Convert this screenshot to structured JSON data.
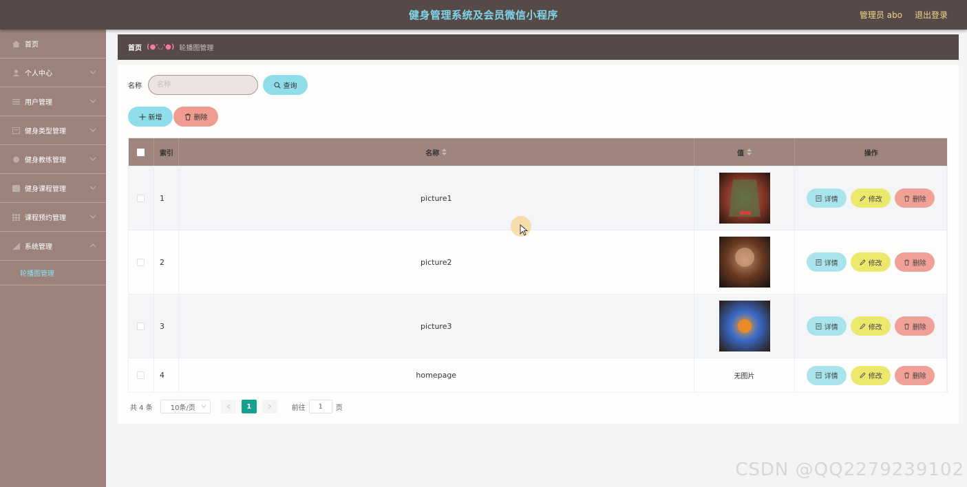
{
  "header": {
    "title": "健身管理系统及会员微信小程序",
    "user": "管理员 abo",
    "logout": "退出登录"
  },
  "sidebar": {
    "items": [
      {
        "label": "首页",
        "icon": "home-icon",
        "has_chevron": false
      },
      {
        "label": "个人中心",
        "icon": "user-icon",
        "has_chevron": true
      },
      {
        "label": "用户管理",
        "icon": "list-icon",
        "has_chevron": true
      },
      {
        "label": "健身类型管理",
        "icon": "category-icon",
        "has_chevron": true
      },
      {
        "label": "健身教练管理",
        "icon": "coach-icon",
        "has_chevron": true
      },
      {
        "label": "健身课程管理",
        "icon": "course-icon",
        "has_chevron": true
      },
      {
        "label": "课程预约管理",
        "icon": "grid-icon",
        "has_chevron": true
      },
      {
        "label": "系统管理",
        "icon": "settings-icon",
        "has_chevron": true
      }
    ],
    "sub_item": "轮播图管理"
  },
  "breadcrumb": {
    "home": "首页",
    "separator": "(●'◡'●)",
    "current": "轮播图管理"
  },
  "search": {
    "label": "名称",
    "placeholder": "名称",
    "query_button": "查询"
  },
  "actions": {
    "add_button": "新增",
    "delete_button": "删除"
  },
  "table": {
    "columns": {
      "index": "索引",
      "name": "名称",
      "value": "值",
      "operations": "操作"
    },
    "rows": [
      {
        "index": "1",
        "name": "picture1",
        "value": "image:picture1"
      },
      {
        "index": "2",
        "name": "picture2",
        "value": "image:picture2"
      },
      {
        "index": "3",
        "name": "picture3",
        "value": "image:picture3"
      },
      {
        "index": "4",
        "name": "homepage",
        "value": "无图片"
      }
    ],
    "row_buttons": {
      "detail": "详情",
      "edit": "修改",
      "remove": "删除"
    }
  },
  "pagination": {
    "total": "共 4 条",
    "page_size": "10条/页",
    "current_page": "1",
    "goto_label": "前往",
    "goto_value": "1",
    "page_suffix": "页"
  },
  "watermark": "CSDN @QQ2279239102",
  "colors": {
    "topbar": "#554a48",
    "title": "#7fd6e8",
    "sidebar": "#9b837c",
    "table_header": "#9f857e",
    "detail_button": "#a9e4ec",
    "edit_button": "#ece86e",
    "delete_button": "#f0a096",
    "page_active": "#16a08f"
  }
}
